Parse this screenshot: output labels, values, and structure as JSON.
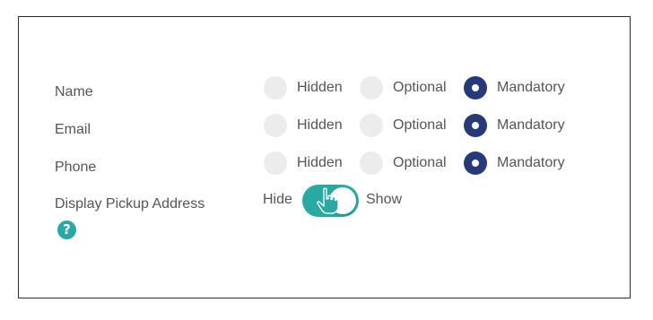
{
  "fields": [
    {
      "label": "Name",
      "options": [
        "Hidden",
        "Optional",
        "Mandatory"
      ],
      "selected": "Mandatory"
    },
    {
      "label": "Email",
      "options": [
        "Hidden",
        "Optional",
        "Mandatory"
      ],
      "selected": "Mandatory"
    },
    {
      "label": "Phone",
      "options": [
        "Hidden",
        "Optional",
        "Mandatory"
      ],
      "selected": "Mandatory"
    }
  ],
  "pickup": {
    "label": "Display Pickup Address",
    "off_label": "Hide",
    "on_label": "Show",
    "enabled": true,
    "help_icon": "question-circle-icon",
    "help_glyph": "?"
  },
  "colors": {
    "selected_radio": "#263a7a",
    "unselected_radio": "#ececec",
    "toggle_on": "#2aa9a4",
    "help_icon": "#2aa9a4",
    "text": "#555555"
  }
}
